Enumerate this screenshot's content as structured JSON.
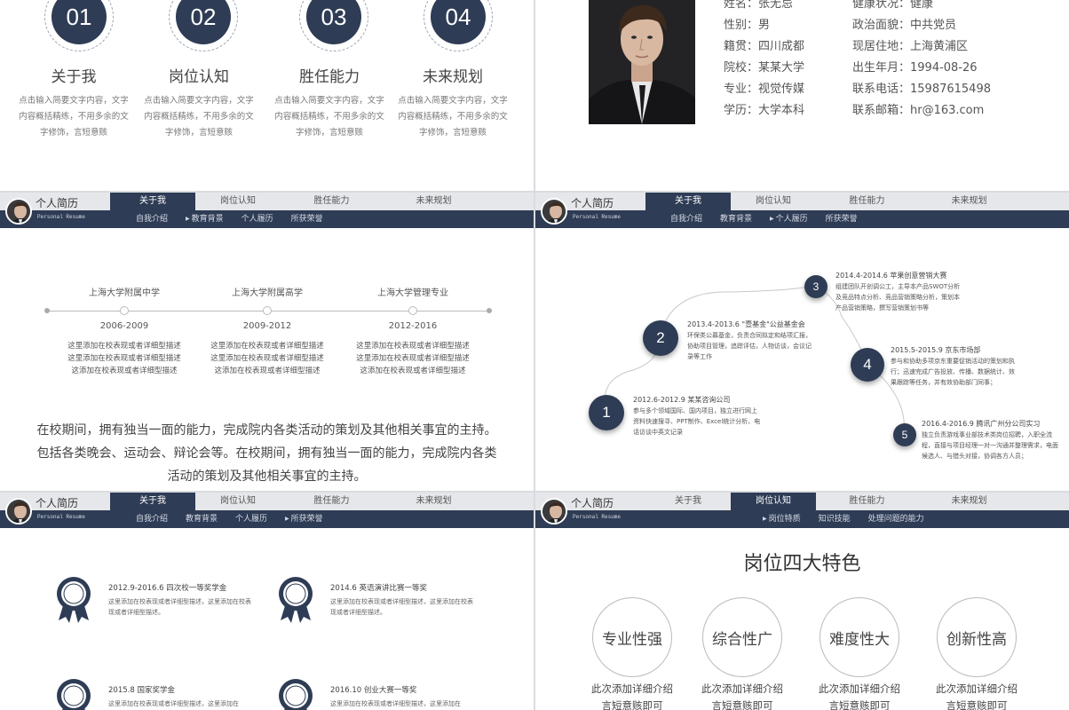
{
  "header": {
    "title": "个人简历",
    "subtitle": "Personal Resume",
    "tabs": [
      "关于我",
      "岗位认知",
      "胜任能力",
      "未来规划"
    ],
    "about_subs": [
      "自我介绍",
      "教育背景",
      "个人履历",
      "所获荣誉"
    ],
    "job_subs": [
      "岗位特质",
      "知识技能",
      "处理问题的能力"
    ]
  },
  "slide1": {
    "items": [
      {
        "num": "01",
        "label": "关于我",
        "desc": "点击输入简要文字内容，文字内容概括精练，不用多余的文字修饰，言短意赅"
      },
      {
        "num": "02",
        "label": "岗位认知",
        "desc": "点击输入简要文字内容，文字内容概括精练，不用多余的文字修饰，言短意赅"
      },
      {
        "num": "03",
        "label": "胜任能力",
        "desc": "点击输入简要文字内容，文字内容概括精练，不用多余的文字修饰，言短意赅"
      },
      {
        "num": "04",
        "label": "未来规划",
        "desc": "点击输入简要文字内容，文字内容概括精练，不用多余的文字修饰，言短意赅"
      }
    ]
  },
  "slide2": {
    "left": [
      "姓名：张无忌",
      "性别：男",
      "籍贯：四川成都",
      "院校：某某大学",
      "专业：视觉传媒",
      "学历：大学本科"
    ],
    "right": [
      "健康状况：健康",
      "政治面貌：中共党员",
      "现居住地：上海黄浦区",
      "出生年月：1994-08-26",
      "联系电话：15987615498",
      "联系邮箱：hr@163.com"
    ]
  },
  "slide3": {
    "schools": [
      {
        "name": "上海大学附属中学",
        "years": "2006-2009",
        "desc": "这里添加在校表现或者详细型描述\n这里添加在校表现或者详细型描述\n这添加在校表现或者详细型描述"
      },
      {
        "name": "上海大学附属高学",
        "years": "2009-2012",
        "desc": "这里添加在校表现或者详细型描述\n这里添加在校表现或者详细型描述\n这添加在校表现或者详细型描述"
      },
      {
        "name": "上海大学管理专业",
        "years": "2012-2016",
        "desc": "这里添加在校表现或者详细型描述\n这里添加在校表现或者详细型描述\n这添加在校表现或者详细型描述"
      }
    ],
    "paragraph": "在校期间，拥有独当一面的能力，完成院内各类活动的策划及其他相关事宜的主持。包括各类晚会、运动会、辩论会等。在校期间，拥有独当一面的能力，完成院内各类活动的策划及其他相关事宜的主持。"
  },
  "slide4": {
    "events": [
      {
        "n": "1",
        "title": "2012.6-2012.9  某某咨询公司",
        "desc": "参与多个领域国际、国内项目，独立进行网上资料快速搜寻、PPT制作、Excel统计分析、电话访谈中英文记录"
      },
      {
        "n": "2",
        "title": "2013.4-2013.6  \"壹基金\"公益基金会",
        "desc": "环保类公募基金，负责合同拟定和结项汇报，协助项目管理，追踪评估，人物访谈，会议记录等工作"
      },
      {
        "n": "3",
        "title": "2014.4-2014.6  苹果创意营销大赛",
        "desc": "组建团队开创调公工，主导本产品SWOT分析及竞品特点分析、竞品营销策略分析，策划本产品营销策略，撰写营销策划书等"
      },
      {
        "n": "4",
        "title": "2015.5-2015.9  京东市场部",
        "desc": "参与和协助多项京东重要促销活动的策划和执行；迅速完成广告投放、传播、数据统计、效果跟踪等任务，并有效协助部门同事；"
      },
      {
        "n": "5",
        "title": "2016.4-2016.9  腾讯广州分公司实习",
        "desc": "独立负责游戏事业部技术类岗位招聘，入职全流程，直接与项目经理一对一沟通并整理需求，电面候选人、与猎头对接，协调各方人员；"
      }
    ]
  },
  "slide5": {
    "awards": [
      {
        "title": "2012.9-2016.6  四次校一等奖学金",
        "desc": "这里添加在校表现或者详细型描述，这里添加在校表现或者详细型描述。"
      },
      {
        "title": "2014.6  英语演讲比赛一等奖",
        "desc": "这里添加在校表现或者详细型描述，这里添加在校表现或者详细型描述。"
      },
      {
        "title": "2015.8  国家奖学金",
        "desc": "这里添加在校表现或者详细型描述，这里添加在"
      },
      {
        "title": "2016.10  创业大赛一等奖",
        "desc": "这里添加在校表现或者详细型描述，这里添加在"
      }
    ]
  },
  "slide6": {
    "title": "岗位四大特色",
    "features": [
      {
        "label": "专业性强",
        "desc": "此次添加详细介绍\n言短意赅即可"
      },
      {
        "label": "综合性广",
        "desc": "此次添加详细介绍\n言短意赅即可"
      },
      {
        "label": "难度性大",
        "desc": "此次添加详细介绍\n言短意赅即可"
      },
      {
        "label": "创新性高",
        "desc": "此次添加详细介绍\n言短意赅即可"
      }
    ]
  },
  "colors": {
    "navy": "#2e3c55",
    "header_bg": "#e6e7ea"
  }
}
